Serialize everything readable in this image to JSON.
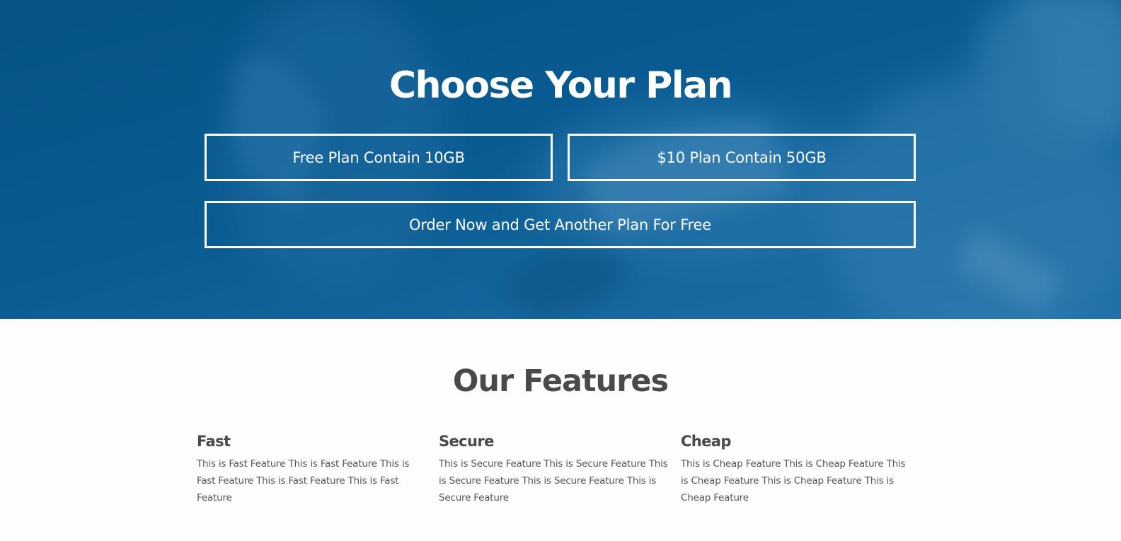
{
  "hero": {
    "title": "Choose Your Plan",
    "plans": {
      "free_label": "Free Plan Contain 10GB",
      "ten_label": "$10 Plan Contain 50GB",
      "order_label": "Order Now and Get Another Plan For Free"
    },
    "background_image": "blurred-workspace-photo",
    "overlay_color": "#0a5a91"
  },
  "features": {
    "title": "Our Features",
    "items": [
      {
        "heading": "Fast",
        "text": "This is Fast Feature This is Fast Feature This is Fast Feature This is Fast Feature This is Fast Feature"
      },
      {
        "heading": "Secure",
        "text": "This is Secure Feature This is Secure Feature This is Secure Feature This is Secure Feature This is Secure Feature"
      },
      {
        "heading": "Cheap",
        "text": "This is Cheap Feature This is Cheap Feature This is Cheap Feature This is Cheap Feature This is Cheap Feature"
      }
    ]
  },
  "colors": {
    "hero_blue": "#0a5a91",
    "heading_gray": "#4a4a4a",
    "text_gray": "#555555",
    "button_border": "#ffffff"
  }
}
